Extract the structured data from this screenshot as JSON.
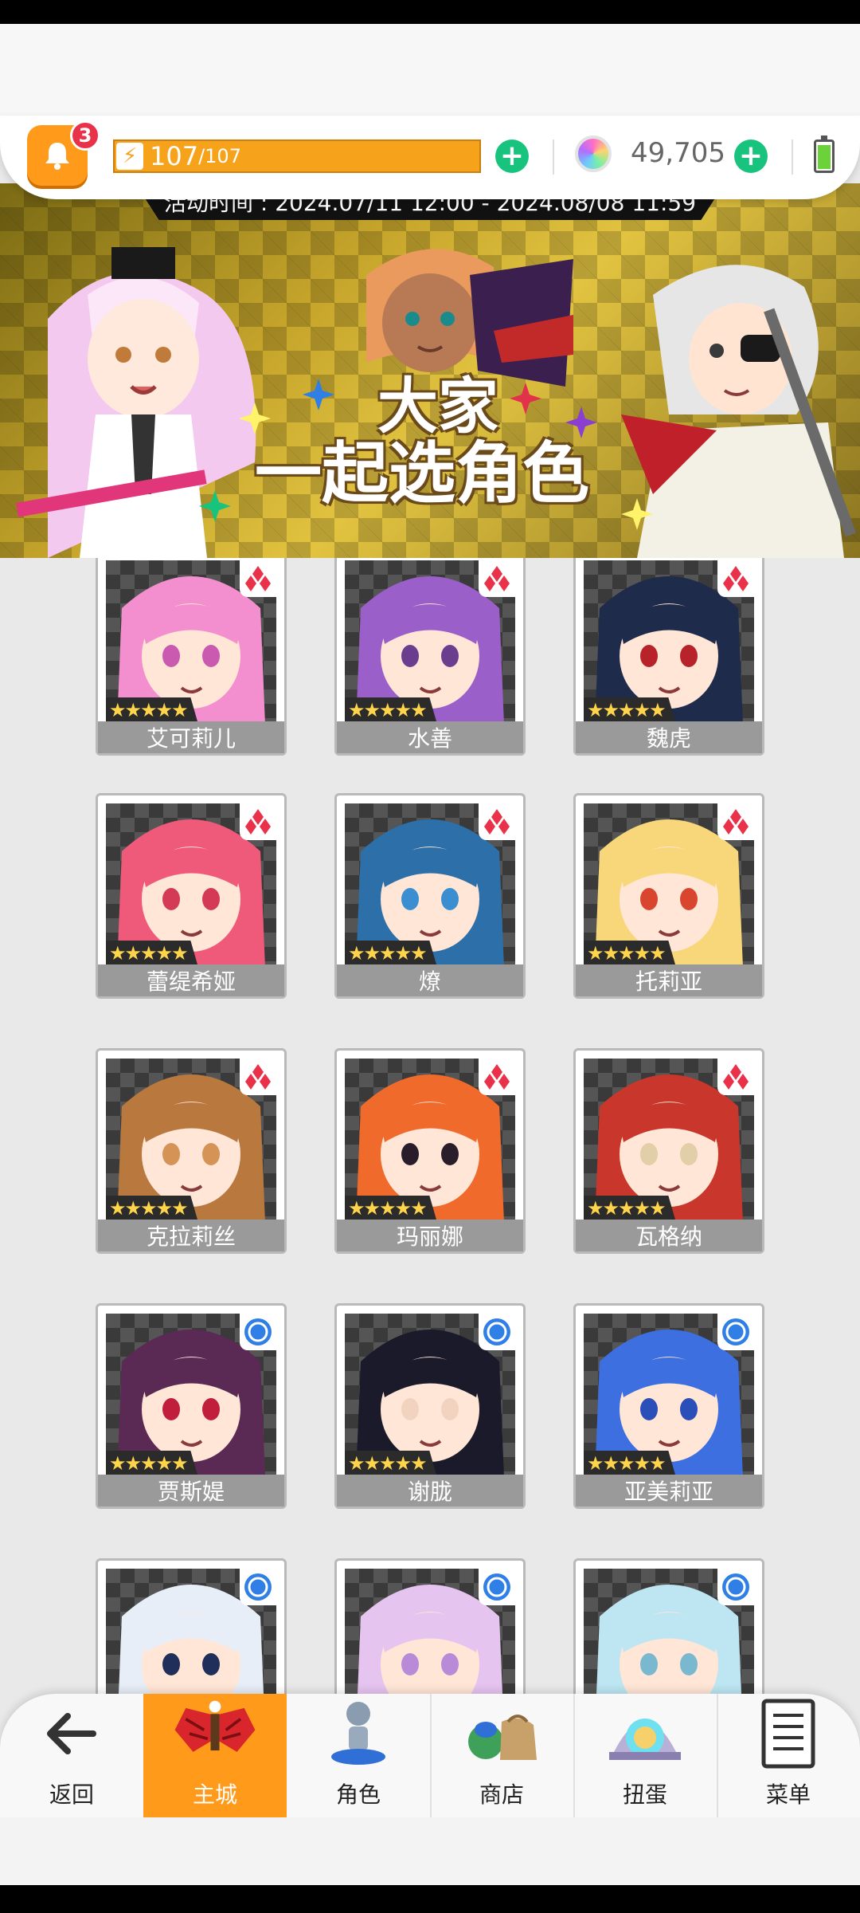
{
  "notifications": {
    "count": "3"
  },
  "energy": {
    "current": "107",
    "max": "/107"
  },
  "gems": {
    "amount": "49,705"
  },
  "banner": {
    "event_time": "活动时间 : 2024.07/11 12:00 - 2024.08/08 11:59",
    "title_line1": "大家",
    "title_line2": "一起选角色"
  },
  "characters": [
    {
      "name": "艾可莉儿",
      "stars": "★★★★★",
      "badge": "diamond",
      "hair": "#f48fcf",
      "bg": "#c95ab0"
    },
    {
      "name": "水善",
      "stars": "★★★★★",
      "badge": "diamond",
      "hair": "#9b5fc9",
      "bg": "#6b3d8f"
    },
    {
      "name": "魏虎",
      "stars": "★★★★★",
      "badge": "diamond",
      "hair": "#1f2b4a",
      "bg": "#b8232b"
    },
    {
      "name": "蕾缇希娅",
      "stars": "★★★★★",
      "badge": "diamond",
      "hair": "#f05a7a",
      "bg": "#d43a55"
    },
    {
      "name": "燎",
      "stars": "★★★★★",
      "badge": "diamond",
      "hair": "#2d6fa8",
      "bg": "#3b8fd0"
    },
    {
      "name": "托莉亚",
      "stars": "★★★★★",
      "badge": "diamond",
      "hair": "#f7d77a",
      "bg": "#d9462f"
    },
    {
      "name": "克拉莉丝",
      "stars": "★★★★★",
      "badge": "diamond",
      "hair": "#b8783e",
      "bg": "#d59356"
    },
    {
      "name": "玛丽娜",
      "stars": "★★★★★",
      "badge": "diamond",
      "hair": "#f06a2c",
      "bg": "#2a1d2a"
    },
    {
      "name": "瓦格纳",
      "stars": "★★★★★",
      "badge": "diamond",
      "hair": "#c9362b",
      "bg": "#e0cfa8"
    },
    {
      "name": "贾斯媞",
      "stars": "★★★★★",
      "badge": "circle",
      "hair": "#5a2a55",
      "bg": "#c01e3b"
    },
    {
      "name": "谢胧",
      "stars": "★★★★★",
      "badge": "circle",
      "hair": "#1a1a2a",
      "bg": "#f2d3c0"
    },
    {
      "name": "亚美莉亚",
      "stars": "★★★★★",
      "badge": "circle",
      "hair": "#3d6fe0",
      "bg": "#2b4fb8"
    },
    {
      "name": "",
      "stars": "",
      "badge": "circle",
      "hair": "#e8eef8",
      "bg": "#1f2f5a"
    },
    {
      "name": "",
      "stars": "",
      "badge": "circle",
      "hair": "#e6c4f0",
      "bg": "#b98ad8"
    },
    {
      "name": "",
      "stars": "",
      "badge": "circle",
      "hair": "#bde6f2",
      "bg": "#7ab8d0"
    }
  ],
  "nav": {
    "back": "返回",
    "home": "主城",
    "characters": "角色",
    "shop": "商店",
    "gacha": "扭蛋",
    "menu": "菜单"
  },
  "colors": {
    "accent": "#ff9a1a",
    "plus": "#18c37e",
    "badge_red": "#e9324a",
    "circle_blue": "#2f7fe6"
  }
}
